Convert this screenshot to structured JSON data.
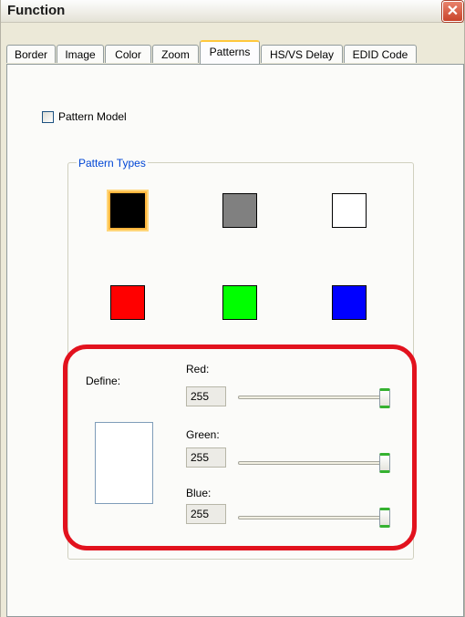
{
  "window": {
    "title": "Function"
  },
  "tabs": [
    {
      "label": "Border"
    },
    {
      "label": "Image"
    },
    {
      "label": "Color"
    },
    {
      "label": "Zoom"
    },
    {
      "label": "Patterns",
      "active": true
    },
    {
      "label": "HS/VS Delay"
    },
    {
      "label": "EDID Code"
    }
  ],
  "pattern_model": {
    "label": "Pattern Model",
    "checked": false
  },
  "pattern_types": {
    "label": "Pattern Types",
    "swatches": [
      {
        "color": "#000000",
        "selected": true
      },
      {
        "color": "#808080",
        "selected": false
      },
      {
        "color": "#ffffff",
        "selected": false
      },
      {
        "color": "#ff0000",
        "selected": false
      },
      {
        "color": "#00ff00",
        "selected": false
      },
      {
        "color": "#0000ff",
        "selected": false
      }
    ]
  },
  "define": {
    "label": "Define:",
    "preview_color": "#ffffff",
    "channels": [
      {
        "label": "Red:",
        "value": "255",
        "max": 255
      },
      {
        "label": "Green:",
        "value": "255",
        "max": 255
      },
      {
        "label": "Blue:",
        "value": "255",
        "max": 255
      }
    ]
  },
  "annotation": {
    "color": "#e2121e"
  }
}
